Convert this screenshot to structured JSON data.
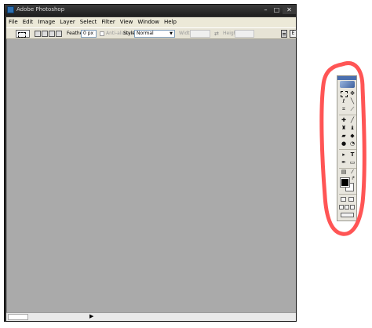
{
  "window": {
    "title": "Adobe Photoshop",
    "controls": {
      "minimize": "–",
      "maximize": "□",
      "close": "✕"
    }
  },
  "menu": [
    "File",
    "Edit",
    "Image",
    "Layer",
    "Select",
    "Filter",
    "View",
    "Window",
    "Help"
  ],
  "options_bar": {
    "feather_label": "Feather:",
    "feather_value": "0 px",
    "antialiased_label": "Anti-aliased",
    "style_label": "Style:",
    "style_value": "Normal",
    "width_label": "Width:",
    "height_label": "Height:",
    "palette_well_label": "E"
  },
  "status_bar": {
    "arrow": "▶"
  },
  "tools": {
    "selection_tool": "▸",
    "type_tool": "T"
  },
  "colors": {
    "annotation": "#ff5555",
    "workspace": "#aaaaaa",
    "foreground": "#000000",
    "background": "#ffffff"
  }
}
